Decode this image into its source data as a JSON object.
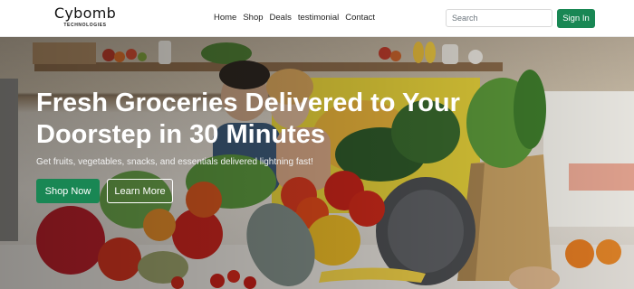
{
  "brand": {
    "name": "Cybomb",
    "subtitle": "TECHNOLOGIES"
  },
  "nav": {
    "links": [
      {
        "label": "Home"
      },
      {
        "label": "Shop"
      },
      {
        "label": "Deals"
      },
      {
        "label": "testimonial"
      },
      {
        "label": "Contact"
      }
    ],
    "search_placeholder": "Search",
    "signin_label": "Sign In"
  },
  "hero": {
    "title": "Fresh Groceries Delivered to Your Doorstep in 30 Minutes",
    "subtitle": "Get fruits, vegetables, snacks, and essentials delivered lightning fast!",
    "primary_button": "Shop Now",
    "secondary_button": "Learn More"
  },
  "colors": {
    "accent": "#198754",
    "hero_text": "#ffffff"
  }
}
